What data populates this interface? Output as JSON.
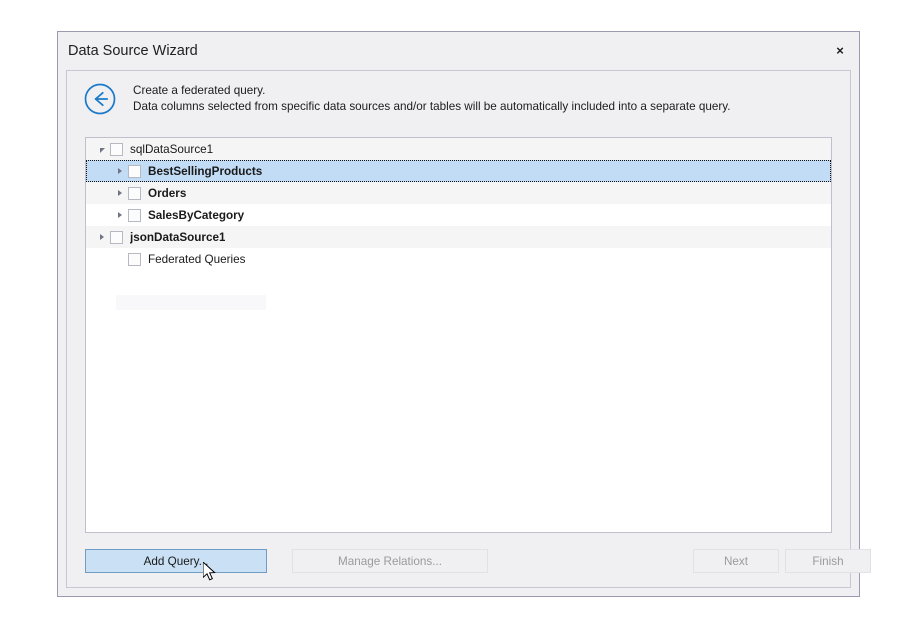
{
  "window": {
    "title": "Data Source Wizard",
    "close_label": "×",
    "close_icon": "close-icon"
  },
  "banner": {
    "back_icon": "back-arrow-circle-icon",
    "heading": "Create a federated query.",
    "description": "Data columns selected from specific data sources and/or tables will be automatically included into a separate query."
  },
  "tree": {
    "rows": [
      {
        "label": "sqlDataSource1",
        "indent": 8,
        "expander": "down",
        "bold": false,
        "checked": false,
        "selected": false,
        "stripe": "alt-a"
      },
      {
        "label": "BestSellingProducts",
        "indent": 26,
        "expander": "right",
        "bold": true,
        "checked": false,
        "selected": true,
        "stripe": "alt-b"
      },
      {
        "label": "Orders",
        "indent": 26,
        "expander": "right",
        "bold": true,
        "checked": false,
        "selected": false,
        "stripe": "alt-a"
      },
      {
        "label": "SalesByCategory",
        "indent": 26,
        "expander": "right",
        "bold": true,
        "checked": false,
        "selected": false,
        "stripe": "alt-b"
      },
      {
        "label": "jsonDataSource1",
        "indent": 8,
        "expander": "right",
        "bold": true,
        "checked": false,
        "selected": false,
        "stripe": "alt-a"
      },
      {
        "label": "Federated Queries",
        "indent": 26,
        "expander": "none",
        "bold": false,
        "checked": false,
        "selected": false,
        "stripe": "alt-b"
      }
    ]
  },
  "footer": {
    "add_query": "Add Query...",
    "manage_relations": "Manage Relations...",
    "next": "Next",
    "finish": "Finish"
  },
  "colors": {
    "selection_blue": "#c3dcf5",
    "hover_button_blue": "#c9e0f5",
    "hover_button_border": "#6f9cc4",
    "accent_icon_blue": "#1b79c8",
    "dialog_chrome": "#f0f0f2",
    "disabled_text": "#9a9a9f",
    "panel_border": "#c0c0cc",
    "row_stripe": "#f5f5f5"
  }
}
